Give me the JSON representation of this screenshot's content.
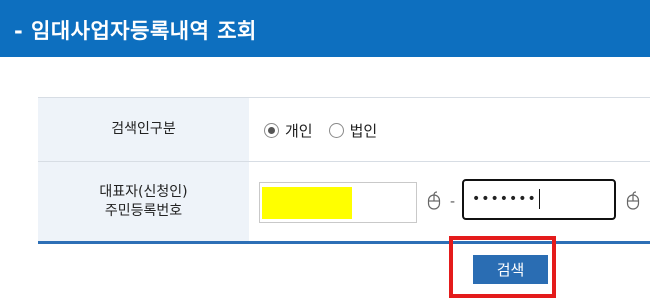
{
  "page": {
    "title": "- 임대사업자등록내역 조회"
  },
  "form": {
    "search_type": {
      "label": "검색인구분",
      "options": [
        {
          "label": "개인",
          "selected": true
        },
        {
          "label": "법인",
          "selected": false
        }
      ]
    },
    "representative": {
      "label_line1": "대표자(신청인)",
      "label_line2": "주민등록번호",
      "separator": "-",
      "second_value_masked": "•••••••"
    }
  },
  "actions": {
    "search_label": "검색"
  },
  "icons": {
    "keypad": "mouse-icon"
  },
  "colors": {
    "header": "#0d6fbf",
    "button": "#2a6db3",
    "highlight": "#e41b1b",
    "mask": "#ffff00"
  }
}
